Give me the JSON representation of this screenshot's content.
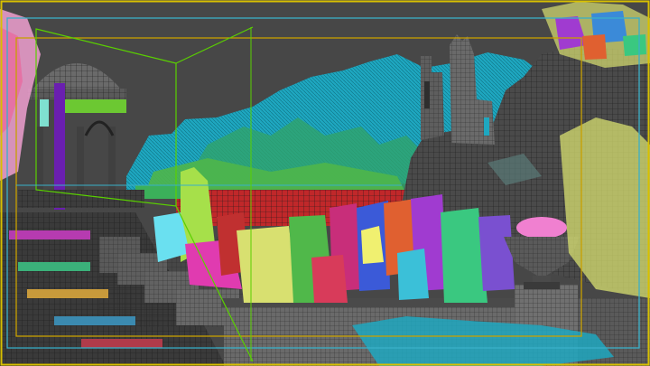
{
  "viewport": {
    "type": "3d-viewport",
    "render_mode": "wireframe-over-shaded",
    "background_color": "#474747",
    "border_color": "#d8d000",
    "frame_guides": [
      {
        "name": "safe-frame-outer",
        "color": "#d8c000"
      },
      {
        "name": "safe-frame-action",
        "color": "#3ab0c8"
      },
      {
        "name": "safe-frame-title",
        "color": "#c8a000"
      },
      {
        "name": "camera-frustum",
        "color": "#5ad000"
      }
    ]
  },
  "scene_objects": [
    {
      "name": "gazebo-dome",
      "kind": "architecture"
    },
    {
      "name": "castle-ruin-tower",
      "kind": "architecture"
    },
    {
      "name": "rock-cliff",
      "kind": "terrain"
    },
    {
      "name": "mountain-range",
      "kind": "terrain",
      "color": "#1ea7c0"
    },
    {
      "name": "flower-beds",
      "kind": "vegetation"
    },
    {
      "name": "stone-urn",
      "kind": "prop"
    },
    {
      "name": "balustrade-wall",
      "kind": "architecture"
    },
    {
      "name": "stone-stairs",
      "kind": "architecture"
    },
    {
      "name": "tree-pink",
      "kind": "vegetation",
      "color": "#f0a0d0"
    },
    {
      "name": "tree-yellow",
      "kind": "vegetation",
      "color": "#d8e070"
    }
  ]
}
